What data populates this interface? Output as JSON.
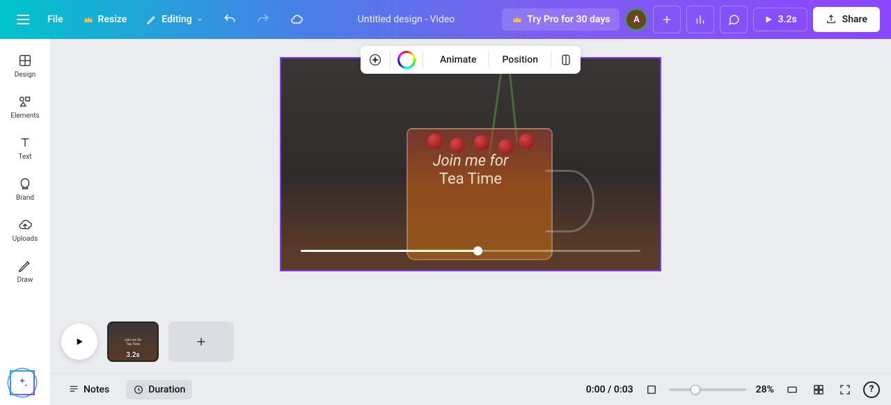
{
  "topbar": {
    "file_label": "File",
    "resize_label": "Resize",
    "editing_label": "Editing",
    "title": "Untitled design - Video",
    "try_pro_label": "Try Pro for 30 days",
    "avatar_initial": "A",
    "time_label": "3.2s",
    "share_label": "Share"
  },
  "sidebar": {
    "items": [
      {
        "label": "Design"
      },
      {
        "label": "Elements"
      },
      {
        "label": "Text"
      },
      {
        "label": "Brand"
      },
      {
        "label": "Uploads"
      },
      {
        "label": "Draw"
      }
    ]
  },
  "context_bar": {
    "animate_label": "Animate",
    "position_label": "Position"
  },
  "canvas": {
    "text_line1": "Join me for",
    "text_line2": "Tea Time",
    "progress_percent": 52
  },
  "timeline": {
    "clip_duration": "3.2s"
  },
  "bottombar": {
    "notes_label": "Notes",
    "duration_label": "Duration",
    "time_display": "0:00 / 0:03",
    "zoom_label": "28%",
    "help_label": "?"
  }
}
